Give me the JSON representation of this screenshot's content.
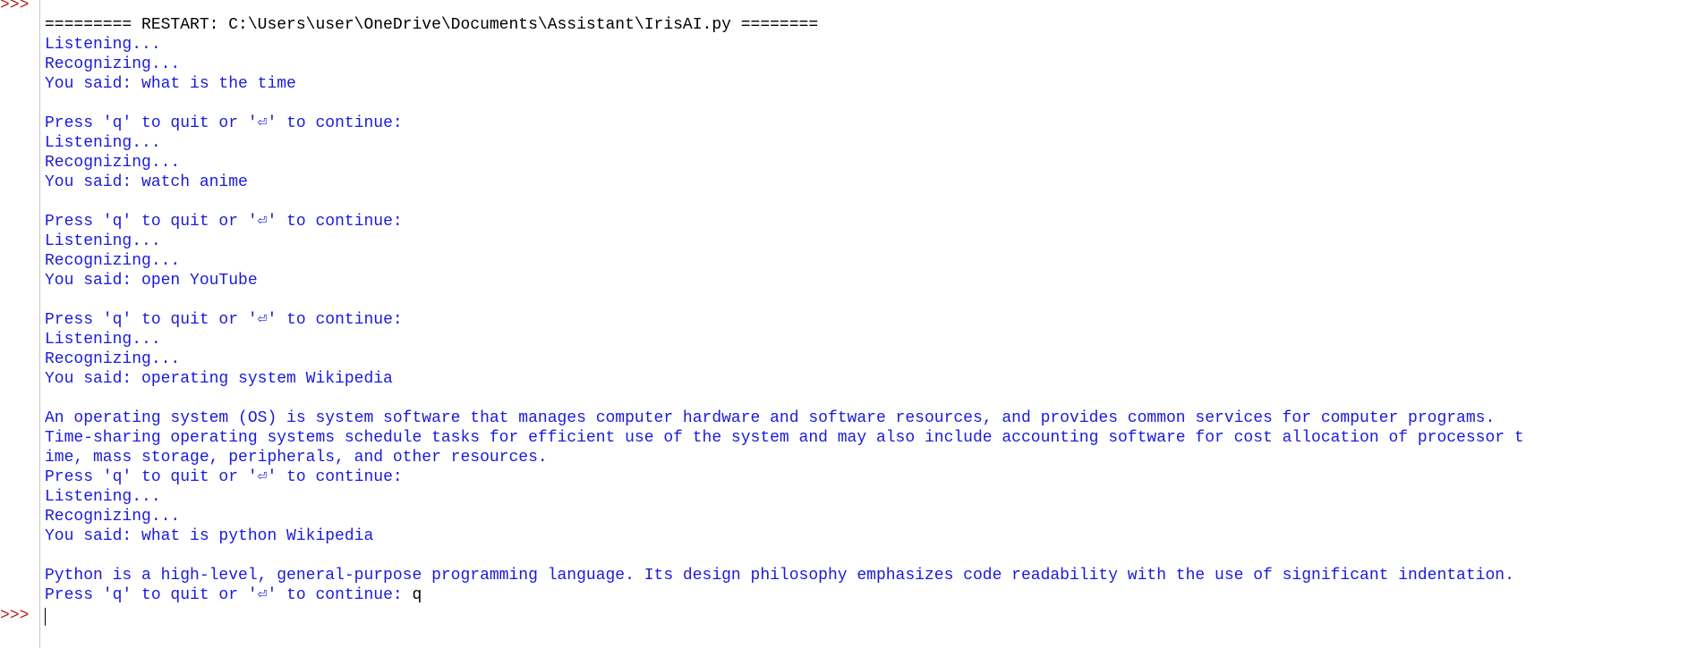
{
  "colors": {
    "prompt": "#b22222",
    "restart": "#000000",
    "stdout": "#1a1adc",
    "input": "#000000"
  },
  "shell": {
    "prompt_top": ">>>",
    "prompt_bottom": ">>>"
  },
  "lines": [
    {
      "text": "========= RESTART: C:\\Users\\user\\OneDrive\\Documents\\Assistant\\IrisAI.py ========",
      "kind": "restart"
    },
    {
      "text": "Listening...",
      "kind": "stdout"
    },
    {
      "text": "Recognizing...",
      "kind": "stdout"
    },
    {
      "text": "You said: what is the time",
      "kind": "stdout"
    },
    {
      "text": "",
      "kind": "stdout"
    },
    {
      "text": "Press 'q' to quit or '⏎' to continue: ",
      "kind": "stdout"
    },
    {
      "text": "Listening...",
      "kind": "stdout"
    },
    {
      "text": "Recognizing...",
      "kind": "stdout"
    },
    {
      "text": "You said: watch anime",
      "kind": "stdout"
    },
    {
      "text": "",
      "kind": "stdout"
    },
    {
      "text": "Press 'q' to quit or '⏎' to continue: ",
      "kind": "stdout"
    },
    {
      "text": "Listening...",
      "kind": "stdout"
    },
    {
      "text": "Recognizing...",
      "kind": "stdout"
    },
    {
      "text": "You said: open YouTube",
      "kind": "stdout"
    },
    {
      "text": "",
      "kind": "stdout"
    },
    {
      "text": "Press 'q' to quit or '⏎' to continue: ",
      "kind": "stdout"
    },
    {
      "text": "Listening...",
      "kind": "stdout"
    },
    {
      "text": "Recognizing...",
      "kind": "stdout"
    },
    {
      "text": "You said: operating system Wikipedia",
      "kind": "stdout"
    },
    {
      "text": "",
      "kind": "stdout"
    },
    {
      "text": "An operating system (OS) is system software that manages computer hardware and software resources, and provides common services for computer programs.",
      "kind": "stdout"
    },
    {
      "text": "Time-sharing operating systems schedule tasks for efficient use of the system and may also include accounting software for cost allocation of processor t",
      "kind": "stdout"
    },
    {
      "text": "ime, mass storage, peripherals, and other resources.",
      "kind": "stdout"
    },
    {
      "text": "Press 'q' to quit or '⏎' to continue: ",
      "kind": "stdout"
    },
    {
      "text": "Listening...",
      "kind": "stdout"
    },
    {
      "text": "Recognizing...",
      "kind": "stdout"
    },
    {
      "text": "You said: what is python Wikipedia",
      "kind": "stdout"
    },
    {
      "text": "",
      "kind": "stdout"
    },
    {
      "text": "Python is a high-level, general-purpose programming language. Its design philosophy emphasizes code readability with the use of significant indentation.",
      "kind": "stdout"
    },
    {
      "text": "Press 'q' to quit or '⏎' to continue: ",
      "kind": "stdout",
      "user_input": "q"
    }
  ]
}
